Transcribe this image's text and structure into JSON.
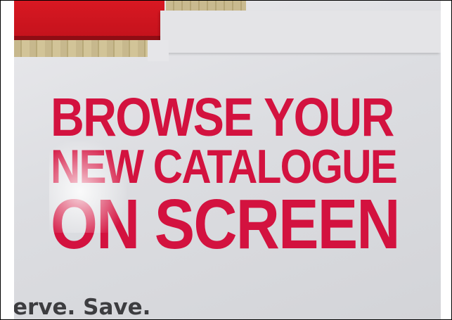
{
  "sign": {
    "line1": "BROWSE YOUR",
    "line2": "NEW CATALOGUE",
    "line3": "ON SCREEN",
    "footer": "erve. Save.",
    "text_color": "#d3123f",
    "accent_red": "#c8141e"
  }
}
